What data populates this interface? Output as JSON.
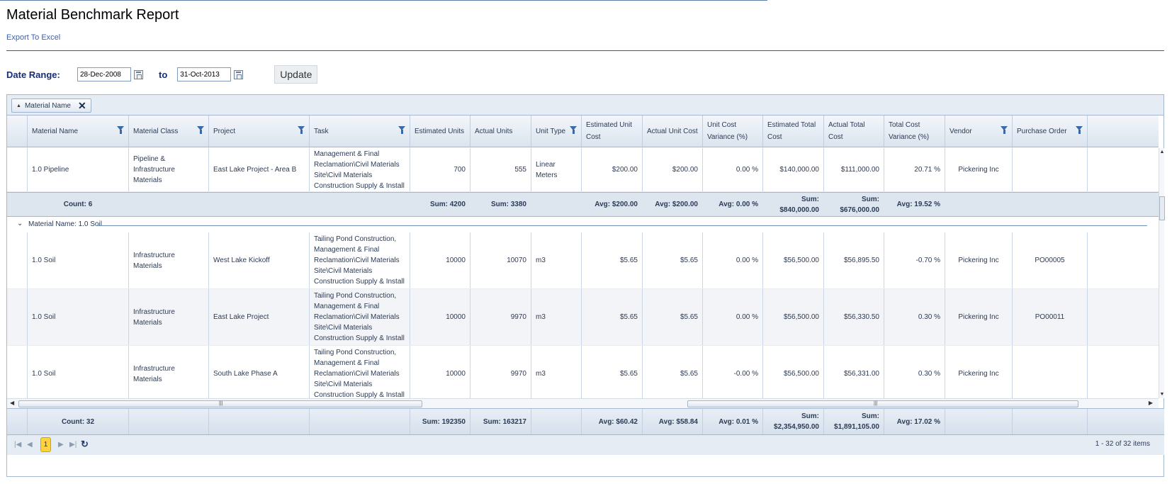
{
  "page": {
    "title": "Material Benchmark Report",
    "export_link": "Export To Excel"
  },
  "date_range": {
    "label": "Date Range:",
    "from": "28-Dec-2008",
    "to_label": "to",
    "to": "31-Oct-2013",
    "update_button": "Update"
  },
  "grouping": {
    "chip_label": "Material Name"
  },
  "columns": [
    {
      "label": "Material Name",
      "filter": true
    },
    {
      "label": "Material Class",
      "filter": true
    },
    {
      "label": "Project",
      "filter": true
    },
    {
      "label": "Task",
      "filter": true
    },
    {
      "label": "Estimated Units",
      "filter": false
    },
    {
      "label": "Actual Units",
      "filter": false
    },
    {
      "label": "Unit Type",
      "filter": true
    },
    {
      "label": "Estimated Unit Cost",
      "filter": false
    },
    {
      "label": "Actual Unit Cost",
      "filter": false
    },
    {
      "label": "Unit Cost Variance (%)",
      "filter": false
    },
    {
      "label": "Estimated Total Cost",
      "filter": false
    },
    {
      "label": "Actual Total Cost",
      "filter": false
    },
    {
      "label": "Total Cost Variance (%)",
      "filter": false
    },
    {
      "label": "Vendor",
      "filter": true
    },
    {
      "label": "Purchase Order",
      "filter": true
    }
  ],
  "partial_row": {
    "material_name": "1.0 Pipeline",
    "material_class": "Pipeline & Infrastructure Materials",
    "project": "East Lake Project - Area B",
    "task": "Management & Final Reclamation\\Civil Materials Site\\Civil Materials Construction Supply & Install",
    "estimated_units": "700",
    "actual_units": "555",
    "unit_type": "Linear Meters",
    "estimated_unit_cost": "$200.00",
    "actual_unit_cost": "$200.00",
    "unit_cost_variance": "0.00 %",
    "estimated_total_cost": "$140,000.00",
    "actual_total_cost": "$111,000.00",
    "total_cost_variance": "20.71 %",
    "vendor": "Pickering Inc",
    "purchase_order": ""
  },
  "pipeline_subtotal": {
    "count": "Count: 6",
    "estimated_units": "Sum: 4200",
    "actual_units": "Sum: 3380",
    "estimated_unit_cost": "Avg: $200.00",
    "actual_unit_cost": "Avg: $200.00",
    "unit_cost_variance": "Avg: 0.00 %",
    "estimated_total_cost_l1": "Sum:",
    "estimated_total_cost_l2": "$840,000.00",
    "actual_total_cost_l1": "Sum:",
    "actual_total_cost_l2": "$676,000.00",
    "total_cost_variance": "Avg: 19.52 %"
  },
  "group_header": {
    "label": "Material Name: 1.0 Soil"
  },
  "rows": [
    {
      "material_name": "1.0 Soil",
      "material_class": "Infrastructure Materials",
      "project": "West Lake Kickoff",
      "task": "Tailing Pond Construction, Management & Final Reclamation\\Civil Materials Site\\Civil Materials Construction Supply & Install",
      "estimated_units": "10000",
      "actual_units": "10070",
      "unit_type": "m3",
      "estimated_unit_cost": "$5.65",
      "actual_unit_cost": "$5.65",
      "unit_cost_variance": "0.00 %",
      "estimated_total_cost": "$56,500.00",
      "actual_total_cost": "$56,895.50",
      "total_cost_variance": "-0.70 %",
      "vendor": "Pickering Inc",
      "purchase_order": "PO00005"
    },
    {
      "material_name": "1.0 Soil",
      "material_class": "Infrastructure Materials",
      "project": "East Lake Project",
      "task": "Tailing Pond Construction, Management & Final Reclamation\\Civil Materials Site\\Civil Materials Construction Supply & Install",
      "estimated_units": "10000",
      "actual_units": "9970",
      "unit_type": "m3",
      "estimated_unit_cost": "$5.65",
      "actual_unit_cost": "$5.65",
      "unit_cost_variance": "0.00 %",
      "estimated_total_cost": "$56,500.00",
      "actual_total_cost": "$56,330.50",
      "total_cost_variance": "0.30 %",
      "vendor": "Pickering Inc",
      "purchase_order": "PO00011"
    },
    {
      "material_name": "1.0 Soil",
      "material_class": "Infrastructure Materials",
      "project": "South Lake Phase A",
      "task": "Tailing Pond Construction, Management & Final Reclamation\\Civil Materials Site\\Civil Materials Construction Supply & Install",
      "estimated_units": "10000",
      "actual_units": "9970",
      "unit_type": "m3",
      "estimated_unit_cost": "$5.65",
      "actual_unit_cost": "$5.65",
      "unit_cost_variance": "-0.00 %",
      "estimated_total_cost": "$56,500.00",
      "actual_total_cost": "$56,331.00",
      "total_cost_variance": "0.30 %",
      "vendor": "Pickering Inc",
      "purchase_order": ""
    }
  ],
  "grand_total": {
    "count": "Count: 32",
    "estimated_units": "Sum: 192350",
    "actual_units": "Sum: 163217",
    "estimated_unit_cost": "Avg: $60.42",
    "actual_unit_cost": "Avg: $58.84",
    "unit_cost_variance": "Avg: 0.01 %",
    "estimated_total_cost_l1": "Sum:",
    "estimated_total_cost_l2": "$2,354,950.00",
    "actual_total_cost_l1": "Sum:",
    "actual_total_cost_l2": "$1,891,105.00",
    "total_cost_variance": "Avg: 17.02 %"
  },
  "pager": {
    "current_page": "1",
    "items_info": "1 - 32 of 32 items"
  }
}
